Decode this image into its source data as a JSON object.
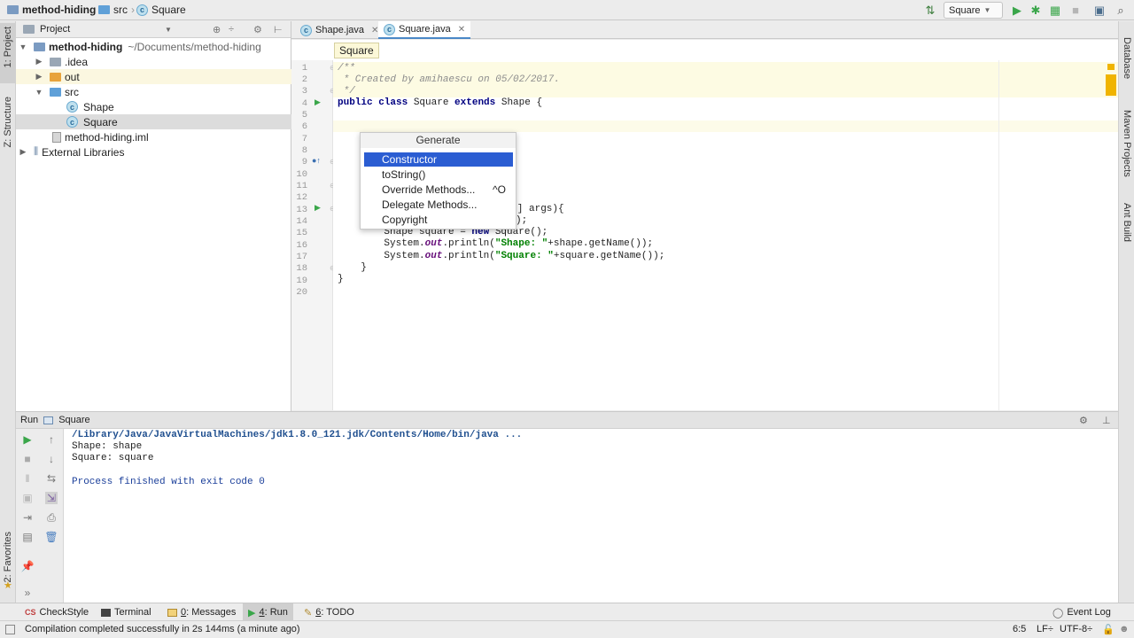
{
  "navbar": {
    "project": "method-hiding",
    "folder": "src",
    "file": "Square",
    "run_config": "Square"
  },
  "left_stripe": {
    "project_tab": "1: Project",
    "structure_tab": "Z: Structure",
    "favorites_tab": "2: Favorites"
  },
  "right_stripe": {
    "database": "Database",
    "maven": "Maven Projects",
    "ant": "Ant Build"
  },
  "project_panel": {
    "header": "Project",
    "root_name": "method-hiding",
    "root_path": "~/Documents/method-hiding",
    "items": [
      {
        "label": ".idea"
      },
      {
        "label": "out"
      },
      {
        "label": "src"
      },
      {
        "label": "Shape"
      },
      {
        "label": "Square"
      },
      {
        "label": "method-hiding.iml"
      },
      {
        "label": "External Libraries"
      }
    ]
  },
  "editor": {
    "tabs": [
      {
        "label": "Shape.java"
      },
      {
        "label": "Square.java"
      }
    ],
    "breadcrumb": "Square",
    "line_numbers": [
      "1",
      "2",
      "3",
      "4",
      "5",
      "6",
      "7",
      "8",
      "9",
      "10",
      "11",
      "12",
      "13",
      "14",
      "15",
      "16",
      "17",
      "18",
      "19",
      "20"
    ],
    "code": {
      "l1": "/**",
      "l2": " * Created by amihaescu on 05/02/2017.",
      "l3": " */",
      "l4_kw": "public class ",
      "l4_name": "Square ",
      "l4_kw2": "extends ",
      "l4_rest": "Shape {",
      "l13": "ng[] args){",
      "l14": ");",
      "l15_a": "    Shape square = ",
      "l15_kw": "new ",
      "l15_b": "Square();",
      "l16_a": "    System.",
      "l16_out": "out",
      "l16_b": ".println(",
      "l16_str": "\"Shape: \"",
      "l16_c": "+shape.getName());",
      "l17_a": "    System.",
      "l17_out": "out",
      "l17_b": ".println(",
      "l17_str": "\"Square: \"",
      "l17_c": "+square.getName());",
      "l18": "  }",
      "l19": "}"
    }
  },
  "generate_popup": {
    "title": "Generate",
    "items": [
      {
        "label": "Constructor",
        "shortcut": ""
      },
      {
        "label": "toString()",
        "shortcut": ""
      },
      {
        "label": "Override Methods...",
        "shortcut": "^O"
      },
      {
        "label": "Delegate Methods...",
        "shortcut": ""
      },
      {
        "label": "Copyright",
        "shortcut": ""
      }
    ]
  },
  "run_panel": {
    "title": "Run",
    "config": "Square",
    "console": [
      "/Library/Java/JavaVirtualMachines/jdk1.8.0_121.jdk/Contents/Home/bin/java ...",
      "Shape: shape",
      "Square: square",
      "Process finished with exit code 0"
    ]
  },
  "bottom_tabs": {
    "checkstyle": "CheckStyle",
    "terminal": "Terminal",
    "messages_num": "0",
    "messages": ": Messages",
    "run_num": "4",
    "run": ": Run",
    "todo_num": "6",
    "todo": ": TODO",
    "event_log": "Event Log"
  },
  "status": {
    "message": "Compilation completed successfully in 2s 144ms (a minute ago)",
    "position": "6:5",
    "line_sep": "LF÷",
    "encoding": "UTF-8÷"
  },
  "colors": {
    "selection": "#2b5dd2",
    "run_green": "#3aa64a",
    "link_blue": "#1b3f9a"
  }
}
